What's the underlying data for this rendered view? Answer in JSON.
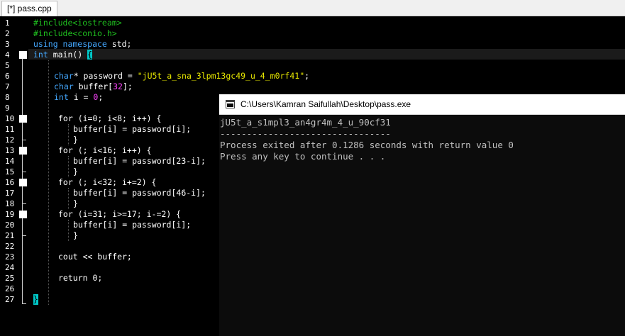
{
  "tab": {
    "label": "[*] pass.cpp"
  },
  "editor": {
    "line_numbers": [
      "1",
      "2",
      "3",
      "4",
      "5",
      "6",
      "7",
      "8",
      "9",
      "10",
      "11",
      "12",
      "13",
      "14",
      "15",
      "16",
      "17",
      "18",
      "19",
      "20",
      "21",
      "22",
      "23",
      "24",
      "25",
      "26",
      "27"
    ],
    "lines": [
      {
        "text": "#include<iostream>"
      },
      {
        "text": "#include<conio.h>"
      },
      {
        "kw": "using namespace",
        "text": " std;"
      },
      {
        "kw": "int",
        "text": " main() ",
        "brace": "{"
      },
      {},
      {
        "kw": "char",
        "text": "* password = ",
        "str": "\"jU5t_a_sna_3lpm13gc49_u_4_m0rf41\"",
        "tail": ";"
      },
      {
        "kw": "char",
        "text": " buffer[",
        "num": "32",
        "tail": "];"
      },
      {
        "kw": "int",
        "text": " i = ",
        "num": "0",
        "tail": ";"
      },
      {},
      {
        "code": "for (i=0; i<8; i++) {"
      },
      {
        "code": "buffer[i] = password[i];"
      },
      {
        "code": "}"
      },
      {
        "code": "for (; i<16; i++) {"
      },
      {
        "code": "buffer[i] = password[23-i];"
      },
      {
        "code": "}"
      },
      {
        "code": "for (; i<32; i+=2) {"
      },
      {
        "code": "buffer[i] = password[46-i];"
      },
      {
        "code": "}"
      },
      {
        "code": "for (i=31; i>=17; i-=2) {"
      },
      {
        "code": "buffer[i] = password[i];"
      },
      {
        "code": "}"
      },
      {},
      {
        "code": "cout << buffer;"
      },
      {},
      {
        "code": "return 0;"
      },
      {},
      {
        "code": "}"
      }
    ]
  },
  "console": {
    "title": "C:\\Users\\Kamran Saifullah\\Desktop\\pass.exe",
    "output": [
      "jU5t_a_s1mpl3_an4gr4m_4_u_90cf31",
      "--------------------------------",
      "Process exited after 0.1286 seconds with return value 0",
      "Press any key to continue . . ."
    ]
  }
}
